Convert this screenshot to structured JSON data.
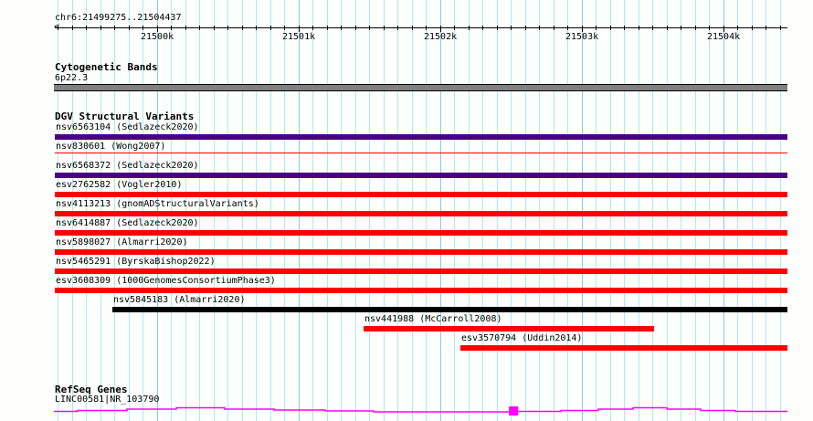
{
  "location": "chr6:21499275..21504437",
  "view": {
    "start": 21499275,
    "end": 21504437
  },
  "ruler_labels": [
    {
      "label": "21500k",
      "pos": 21500000
    },
    {
      "label": "21501k",
      "pos": 21501000
    },
    {
      "label": "21502k",
      "pos": 21502000
    },
    {
      "label": "21503k",
      "pos": 21503000
    },
    {
      "label": "21504k",
      "pos": 21504000
    }
  ],
  "cytoband": {
    "title": "Cytogenetic Bands",
    "label": "6p22.3",
    "color": "#808080"
  },
  "dgv": {
    "title": "DGV Structural Variants",
    "features": [
      {
        "label": "nsv6563104 (Sedlazeck2020)",
        "start": 21499275,
        "end": 21504437,
        "color": "#4b0082",
        "style": "thick"
      },
      {
        "label": "nsv830601 (Wong2007)",
        "start": 21499275,
        "end": 21504437,
        "color": "#ff0000",
        "style": "thin"
      },
      {
        "label": "nsv6568372 (Sedlazeck2020)",
        "start": 21499275,
        "end": 21504437,
        "color": "#4b0082",
        "style": "thick"
      },
      {
        "label": "esv2762582 (Vogler2010)",
        "start": 21499275,
        "end": 21504437,
        "color": "#ff0000",
        "style": "thick"
      },
      {
        "label": "nsv4113213 (gnomADStructuralVariants)",
        "start": 21499275,
        "end": 21504437,
        "color": "#ff0000",
        "style": "thick"
      },
      {
        "label": "nsv6414887 (Sedlazeck2020)",
        "start": 21499275,
        "end": 21504437,
        "color": "#ff0000",
        "style": "thick"
      },
      {
        "label": "nsv5898027 (Almarri2020)",
        "start": 21499275,
        "end": 21504437,
        "color": "#ff0000",
        "style": "thick"
      },
      {
        "label": "nsv5465291 (ByrskaBishop2022)",
        "start": 21499275,
        "end": 21504437,
        "color": "#ff0000",
        "style": "thick"
      },
      {
        "label": "esv3608309 (1000GenomesConsortiumPhase3)",
        "start": 21499275,
        "end": 21504437,
        "color": "#ff0000",
        "style": "thick"
      },
      {
        "label": "nsv5845183 (Almarri2020)",
        "start": 21499684,
        "end": 21504437,
        "color": "#000000",
        "style": "thick"
      },
      {
        "label": "nsv441988 (McCarroll2008)",
        "start": 21501458,
        "end": 21503510,
        "color": "#ff0000",
        "style": "thick"
      },
      {
        "label": "esv3570794 (Uddin2014)",
        "start": 21502142,
        "end": 21504437,
        "color": "#ff0000",
        "style": "thick"
      }
    ]
  },
  "refseq": {
    "title": "RefSeq Genes",
    "label": "LINC00581|NR_103790",
    "color": "#ff00ff",
    "exon": {
      "start": 21502485,
      "end": 21502550
    }
  }
}
